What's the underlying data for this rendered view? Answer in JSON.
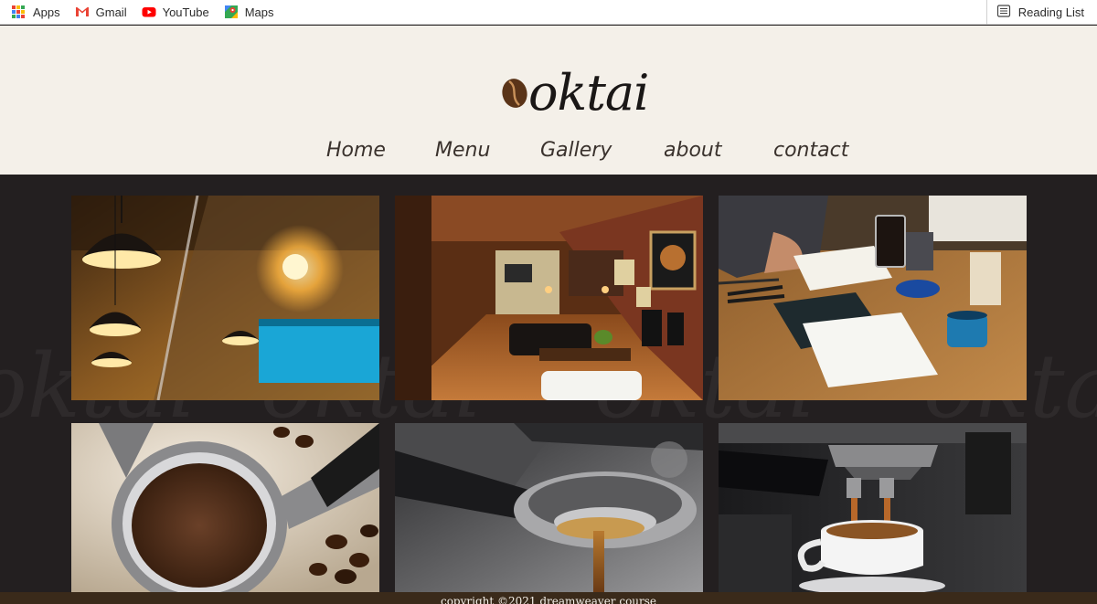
{
  "bookmarks": {
    "items": [
      {
        "label": "Apps",
        "icon": "apps-grid-icon"
      },
      {
        "label": "Gmail",
        "icon": "gmail-icon"
      },
      {
        "label": "YouTube",
        "icon": "youtube-icon"
      },
      {
        "label": "Maps",
        "icon": "maps-icon"
      }
    ],
    "reading_list": "Reading List"
  },
  "site": {
    "logo": "oktai",
    "nav": [
      "Home",
      "Menu",
      "Gallery",
      "about",
      "contact"
    ],
    "watermark": "oktai",
    "colors": {
      "header_bg": "#f4f0e9",
      "body_bg": "#231f20",
      "footer_bg": "#3a2a1a",
      "nav_text": "#3a322d"
    }
  },
  "gallery": {
    "photos": [
      {
        "subject": "pendant-lamps-cafe"
      },
      {
        "subject": "cafe-interior-lounge"
      },
      {
        "subject": "sketching-at-table"
      },
      {
        "subject": "ground-coffee-portafilter"
      },
      {
        "subject": "espresso-pour"
      },
      {
        "subject": "espresso-machine-cup"
      }
    ]
  },
  "footer": {
    "copyright": "copyright ©2021 dreamweaver course"
  }
}
